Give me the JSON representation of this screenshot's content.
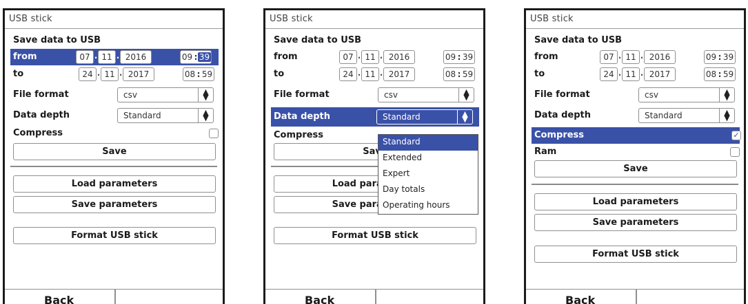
{
  "screens": [
    {
      "title": "USB stick",
      "section": "Save data to USB",
      "from_label": "from",
      "from_day": "07",
      "from_month": "11",
      "from_year": "2016",
      "from_hour": "09",
      "from_min": "39",
      "to_label": "to",
      "to_day": "24",
      "to_month": "11",
      "to_year": "2017",
      "to_hour": "08",
      "to_min": "59",
      "file_format_label": "File format",
      "file_format_value": "csv",
      "data_depth_label": "Data depth",
      "data_depth_value": "Standard",
      "compress_label": "Compress",
      "save_label": "Save",
      "load_params_label": "Load parameters",
      "save_params_label": "Save parameters",
      "format_label": "Format USB stick",
      "back_label": "Back"
    },
    {
      "title": "USB stick",
      "section": "Save data to USB",
      "from_label": "from",
      "from_day": "07",
      "from_month": "11",
      "from_year": "2016",
      "from_hour": "09",
      "from_min": "39",
      "to_label": "to",
      "to_day": "24",
      "to_month": "11",
      "to_year": "2017",
      "to_hour": "08",
      "to_min": "59",
      "file_format_label": "File format",
      "file_format_value": "csv",
      "data_depth_label": "Data depth",
      "data_depth_value": "Standard",
      "compress_label": "Compress",
      "save_label": "Save",
      "load_params_label": "Load parameters",
      "save_params_label": "Save parameters",
      "format_label": "Format USB stick",
      "back_label": "Back",
      "dropdown_options": [
        "Standard",
        "Extended",
        "Expert",
        "Day totals",
        "Operating hours"
      ]
    },
    {
      "title": "USB stick",
      "section": "Save data to USB",
      "from_label": "from",
      "from_day": "07",
      "from_month": "11",
      "from_year": "2016",
      "from_hour": "09",
      "from_min": "39",
      "to_label": "to",
      "to_day": "24",
      "to_month": "11",
      "to_year": "2017",
      "to_hour": "08",
      "to_min": "59",
      "file_format_label": "File format",
      "file_format_value": "csv",
      "data_depth_label": "Data depth",
      "data_depth_value": "Standard",
      "compress_label": "Compress",
      "ram_label": "Ram",
      "save_label": "Save",
      "load_params_label": "Load parameters",
      "save_params_label": "Save parameters",
      "format_label": "Format USB stick",
      "back_label": "Back"
    }
  ],
  "icons": {
    "updown": "updown-arrow-icon",
    "checkmark": "checkmark-icon"
  },
  "colors": {
    "highlight": "#3a51a8",
    "frame": "#1b1b1b"
  }
}
